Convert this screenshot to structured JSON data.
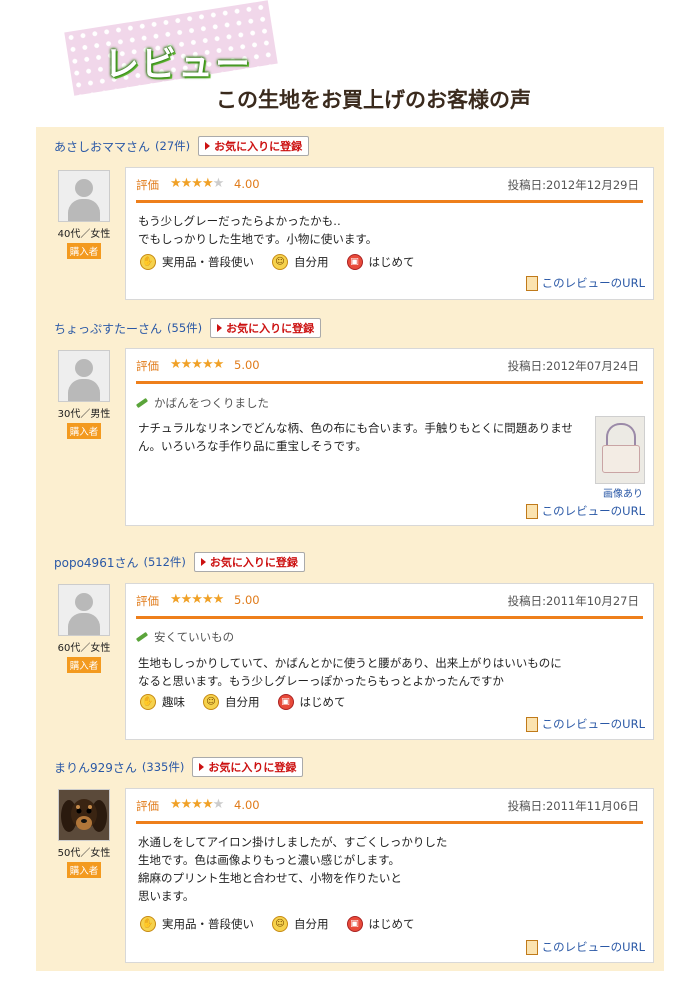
{
  "header": {
    "title": "レビュー",
    "subtitle": "この生地をお買上げのお客様の声"
  },
  "labels": {
    "fav_button": "お気に入りに登録",
    "rating": "評価",
    "posted_prefix": "投稿日:",
    "buyer_badge": "購入者",
    "review_url": "このレビューのURL",
    "photo_caption": "画像あり"
  },
  "reviews": [
    {
      "name": "あさしおママさん",
      "count": "(27件)",
      "demographic": "40代／女性",
      "stars": 4,
      "score": "4.00",
      "date": "2012年12月29日",
      "title": "",
      "body": "もう少しグレーだったらよかったかも‥\nでもしっかりした生地です。小物に使います。",
      "tags": [
        "実用品・普段使い",
        "自分用",
        "はじめて"
      ]
    },
    {
      "name": "ちょっぷすたーさん",
      "count": "(55件)",
      "demographic": "30代／男性",
      "stars": 5,
      "score": "5.00",
      "date": "2012年07月24日",
      "title": "かばんをつくりました",
      "body": "ナチュラルなリネンでどんな柄、色の布にも合います。手触りもとくに問題ありませ\nん。いろいろな手作り品に重宝しそうです。",
      "tags": []
    },
    {
      "name": "popo4961さん",
      "count": "(512件)",
      "demographic": "60代／女性",
      "stars": 5,
      "score": "5.00",
      "date": "2011年10月27日",
      "title": "安くていいもの",
      "body": "生地もしっかりしていて、かばんとかに使うと腰があり、出来上がりはいいものに\nなると思います。もう少しグレーっぽかったらもっとよかったんですか",
      "tags": [
        "趣味",
        "自分用",
        "はじめて"
      ]
    },
    {
      "name": "まりん929さん",
      "count": "(335件)",
      "demographic": "50代／女性",
      "stars": 4,
      "score": "4.00",
      "date": "2011年11月06日",
      "title": "",
      "body": "水通しをしてアイロン掛けしましたが、すごくしっかりした\n生地です。色は画像よりもっと濃い感じがします。\n綿麻のプリント生地と合わせて、小物を作りたいと\n思います。",
      "tags": [
        "実用品・普段使い",
        "自分用",
        "はじめて"
      ]
    }
  ],
  "icons": {
    "tag_hand": "hand-icon",
    "tag_self": "person-icon",
    "tag_first": "gift-icon",
    "link": "document-icon"
  },
  "colors": {
    "accent": "#ee7f1b",
    "link": "#2a58a6",
    "panel": "#fcefd0",
    "buyer": "#f39a1f",
    "fav": "#cc1111"
  }
}
